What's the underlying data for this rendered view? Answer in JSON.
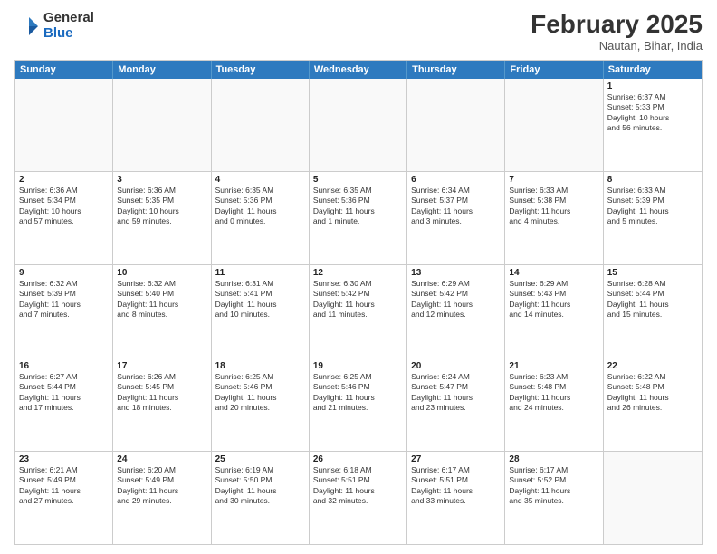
{
  "header": {
    "logo_general": "General",
    "logo_blue": "Blue",
    "month_title": "February 2025",
    "location": "Nautan, Bihar, India"
  },
  "days_of_week": [
    "Sunday",
    "Monday",
    "Tuesday",
    "Wednesday",
    "Thursday",
    "Friday",
    "Saturday"
  ],
  "weeks": [
    [
      {
        "day": "",
        "info": ""
      },
      {
        "day": "",
        "info": ""
      },
      {
        "day": "",
        "info": ""
      },
      {
        "day": "",
        "info": ""
      },
      {
        "day": "",
        "info": ""
      },
      {
        "day": "",
        "info": ""
      },
      {
        "day": "1",
        "info": "Sunrise: 6:37 AM\nSunset: 5:33 PM\nDaylight: 10 hours\nand 56 minutes."
      }
    ],
    [
      {
        "day": "2",
        "info": "Sunrise: 6:36 AM\nSunset: 5:34 PM\nDaylight: 10 hours\nand 57 minutes."
      },
      {
        "day": "3",
        "info": "Sunrise: 6:36 AM\nSunset: 5:35 PM\nDaylight: 10 hours\nand 59 minutes."
      },
      {
        "day": "4",
        "info": "Sunrise: 6:35 AM\nSunset: 5:36 PM\nDaylight: 11 hours\nand 0 minutes."
      },
      {
        "day": "5",
        "info": "Sunrise: 6:35 AM\nSunset: 5:36 PM\nDaylight: 11 hours\nand 1 minute."
      },
      {
        "day": "6",
        "info": "Sunrise: 6:34 AM\nSunset: 5:37 PM\nDaylight: 11 hours\nand 3 minutes."
      },
      {
        "day": "7",
        "info": "Sunrise: 6:33 AM\nSunset: 5:38 PM\nDaylight: 11 hours\nand 4 minutes."
      },
      {
        "day": "8",
        "info": "Sunrise: 6:33 AM\nSunset: 5:39 PM\nDaylight: 11 hours\nand 5 minutes."
      }
    ],
    [
      {
        "day": "9",
        "info": "Sunrise: 6:32 AM\nSunset: 5:39 PM\nDaylight: 11 hours\nand 7 minutes."
      },
      {
        "day": "10",
        "info": "Sunrise: 6:32 AM\nSunset: 5:40 PM\nDaylight: 11 hours\nand 8 minutes."
      },
      {
        "day": "11",
        "info": "Sunrise: 6:31 AM\nSunset: 5:41 PM\nDaylight: 11 hours\nand 10 minutes."
      },
      {
        "day": "12",
        "info": "Sunrise: 6:30 AM\nSunset: 5:42 PM\nDaylight: 11 hours\nand 11 minutes."
      },
      {
        "day": "13",
        "info": "Sunrise: 6:29 AM\nSunset: 5:42 PM\nDaylight: 11 hours\nand 12 minutes."
      },
      {
        "day": "14",
        "info": "Sunrise: 6:29 AM\nSunset: 5:43 PM\nDaylight: 11 hours\nand 14 minutes."
      },
      {
        "day": "15",
        "info": "Sunrise: 6:28 AM\nSunset: 5:44 PM\nDaylight: 11 hours\nand 15 minutes."
      }
    ],
    [
      {
        "day": "16",
        "info": "Sunrise: 6:27 AM\nSunset: 5:44 PM\nDaylight: 11 hours\nand 17 minutes."
      },
      {
        "day": "17",
        "info": "Sunrise: 6:26 AM\nSunset: 5:45 PM\nDaylight: 11 hours\nand 18 minutes."
      },
      {
        "day": "18",
        "info": "Sunrise: 6:25 AM\nSunset: 5:46 PM\nDaylight: 11 hours\nand 20 minutes."
      },
      {
        "day": "19",
        "info": "Sunrise: 6:25 AM\nSunset: 5:46 PM\nDaylight: 11 hours\nand 21 minutes."
      },
      {
        "day": "20",
        "info": "Sunrise: 6:24 AM\nSunset: 5:47 PM\nDaylight: 11 hours\nand 23 minutes."
      },
      {
        "day": "21",
        "info": "Sunrise: 6:23 AM\nSunset: 5:48 PM\nDaylight: 11 hours\nand 24 minutes."
      },
      {
        "day": "22",
        "info": "Sunrise: 6:22 AM\nSunset: 5:48 PM\nDaylight: 11 hours\nand 26 minutes."
      }
    ],
    [
      {
        "day": "23",
        "info": "Sunrise: 6:21 AM\nSunset: 5:49 PM\nDaylight: 11 hours\nand 27 minutes."
      },
      {
        "day": "24",
        "info": "Sunrise: 6:20 AM\nSunset: 5:49 PM\nDaylight: 11 hours\nand 29 minutes."
      },
      {
        "day": "25",
        "info": "Sunrise: 6:19 AM\nSunset: 5:50 PM\nDaylight: 11 hours\nand 30 minutes."
      },
      {
        "day": "26",
        "info": "Sunrise: 6:18 AM\nSunset: 5:51 PM\nDaylight: 11 hours\nand 32 minutes."
      },
      {
        "day": "27",
        "info": "Sunrise: 6:17 AM\nSunset: 5:51 PM\nDaylight: 11 hours\nand 33 minutes."
      },
      {
        "day": "28",
        "info": "Sunrise: 6:17 AM\nSunset: 5:52 PM\nDaylight: 11 hours\nand 35 minutes."
      },
      {
        "day": "",
        "info": ""
      }
    ]
  ]
}
